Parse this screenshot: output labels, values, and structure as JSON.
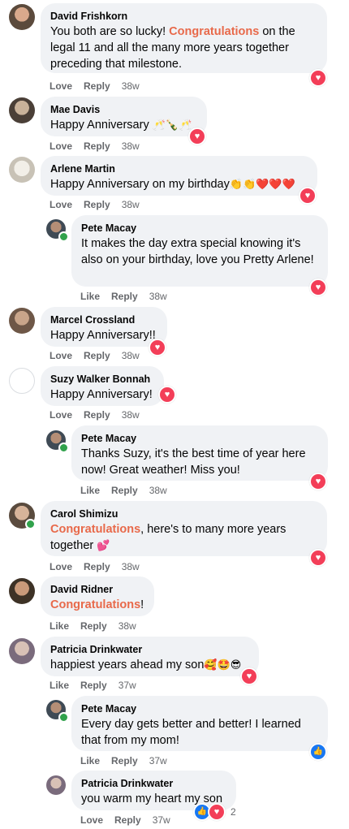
{
  "colors": {
    "highlight": "#e8694a",
    "heart": "#f33e58",
    "like": "#1877f2",
    "bubble": "#f0f2f5",
    "meta": "#65676b"
  },
  "comments": [
    {
      "author": "David Frishkorn",
      "text_a": "You both are so lucky! ",
      "hl": "Congratulations",
      "text_b": " on the legal 11 and all the many more years together preceding that milestone.",
      "love": "Love",
      "reply": "Reply",
      "time": "38w",
      "reaction": "heart-icon"
    },
    {
      "author": "Mae Davis",
      "text": "Happy Anniversary",
      "emoji": "🥂🍾🥂",
      "love": "Love",
      "reply": "Reply",
      "time": "38w",
      "reaction": "heart-icon"
    },
    {
      "author": "Arlene Martin",
      "text": "Happy Anniversary on my birthday",
      "emoji": "👏👏❤️❤️❤️",
      "love": "Love",
      "reply": "Reply",
      "time": "38w",
      "reaction": "heart-icon"
    },
    {
      "author": "Pete Macay",
      "text": "It makes the day extra special knowing it's also on your birthday, love you Pretty Arlene!",
      "like": "Like",
      "reply": "Reply",
      "time": "38w",
      "reaction": "heart-icon"
    },
    {
      "author": "Marcel Crossland",
      "text": "Happy Anniversary!!",
      "love": "Love",
      "reply": "Reply",
      "time": "38w",
      "reaction": "heart-icon"
    },
    {
      "author": "Suzy Walker Bonnah",
      "text": "Happy Anniversary!",
      "love": "Love",
      "reply": "Reply",
      "time": "38w",
      "reaction": "heart-icon"
    },
    {
      "author": "Pete Macay",
      "text": "Thanks Suzy, it's the best time of year here now! Great weather! Miss you!",
      "like": "Like",
      "reply": "Reply",
      "time": "38w",
      "reaction": "heart-icon"
    },
    {
      "author": "Carol Shimizu",
      "hl": "Congratulations",
      "text_b": ", here's to many more years together",
      "emoji": "💕",
      "love": "Love",
      "reply": "Reply",
      "time": "38w",
      "reaction": "heart-icon"
    },
    {
      "author": "David Ridner",
      "hl": "Congratulations",
      "text_b": "!",
      "like": "Like",
      "reply": "Reply",
      "time": "38w"
    },
    {
      "author": "Patricia Drinkwater",
      "text": "happiest years ahead my son",
      "emoji": "🥰🤩😎",
      "like": "Like",
      "reply": "Reply",
      "time": "37w",
      "reaction": "heart-icon"
    },
    {
      "author": "Pete Macay",
      "text": "Every day gets better and better! I learned that from my mom!",
      "like": "Like",
      "reply": "Reply",
      "time": "37w",
      "reaction": "like-icon"
    },
    {
      "author": "Patricia Drinkwater",
      "text": "you warm my heart my son",
      "love": "Love",
      "reply": "Reply",
      "time": "37w",
      "reaction_count": "2"
    }
  ]
}
